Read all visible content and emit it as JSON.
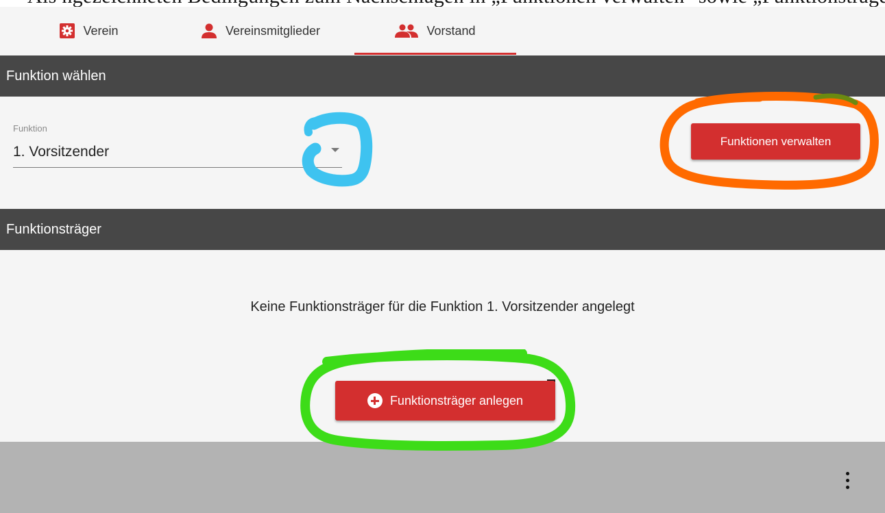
{
  "doc_strip_text": "Als ngezeichneten Bedingungen zum Nachschlagen in „Funktionen verwalten\" sowie „Funktionsträger anlegen\"",
  "tabs": [
    {
      "label": "Verein",
      "icon": "gear-icon",
      "active": false
    },
    {
      "label": "Vereinsmitglieder",
      "icon": "person-icon",
      "active": false
    },
    {
      "label": "Vorstand",
      "icon": "people-icon",
      "active": true
    }
  ],
  "section_funktion": {
    "title": "Funktion wählen",
    "field_label": "Funktion",
    "selected_value": "1. Vorsitzender",
    "manage_button": "Funktionen verwalten"
  },
  "section_traeger": {
    "title": "Funktionsträger",
    "empty_message": "Keine Funktionsträger für die Funktion 1. Vorsitzender angelegt",
    "add_button": "Funktionsträger anlegen"
  },
  "colors": {
    "accent": "#d32f2f",
    "header_bg": "#474747",
    "bottom_bar": "#b3b3b3",
    "annotation_blue": "#3ec3f0",
    "annotation_orange": "#ff6a00",
    "annotation_green": "#3ddc18"
  }
}
